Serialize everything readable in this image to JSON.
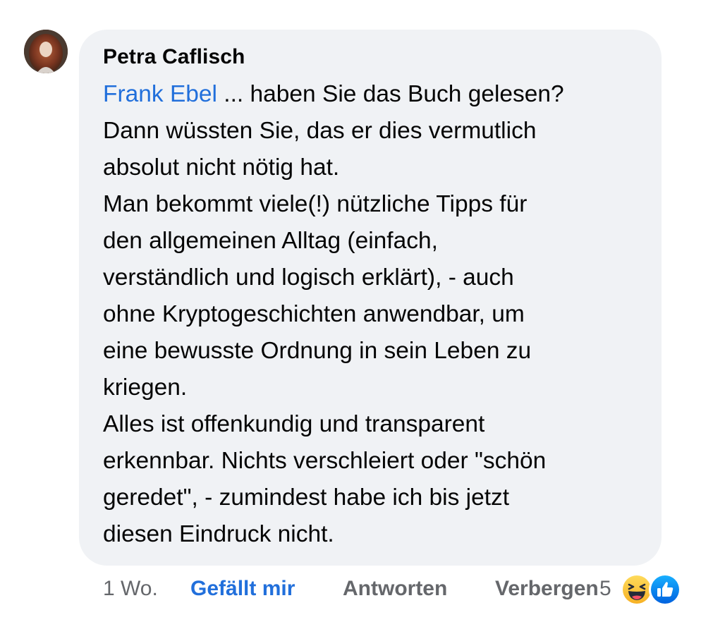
{
  "comment": {
    "author": "Petra Caflisch",
    "mention": "Frank Ebel",
    "lines": [
      " ... haben Sie das Buch gelesen?",
      "Dann wüssten Sie, das er dies vermutlich",
      "absolut nicht nötig hat.",
      "Man bekommt viele(!) nützliche Tipps für",
      "den allgemeinen Alltag (einfach,",
      "verständlich und logisch erklärt), - auch",
      "ohne Kryptogeschichten anwendbar, um",
      "eine bewusste Ordnung in sein Leben zu",
      "kriegen.",
      "Alles ist offenkundig und transparent",
      "erkennbar. Nichts verschleiert oder \"schön",
      "geredet\", - zumindest habe ich bis jetzt",
      "diesen Eindruck nicht."
    ]
  },
  "actions": {
    "time": "1 Wo.",
    "like_label": "Gefällt mir",
    "reply_label": "Antworten",
    "hide_label": "Verbergen"
  },
  "reactions": {
    "count": "5",
    "icons": [
      "haha-reaction-icon",
      "like-reaction-icon"
    ],
    "colors": {
      "like": "#1877f2",
      "haha": "#f7b125",
      "link": "#216fdb"
    }
  }
}
